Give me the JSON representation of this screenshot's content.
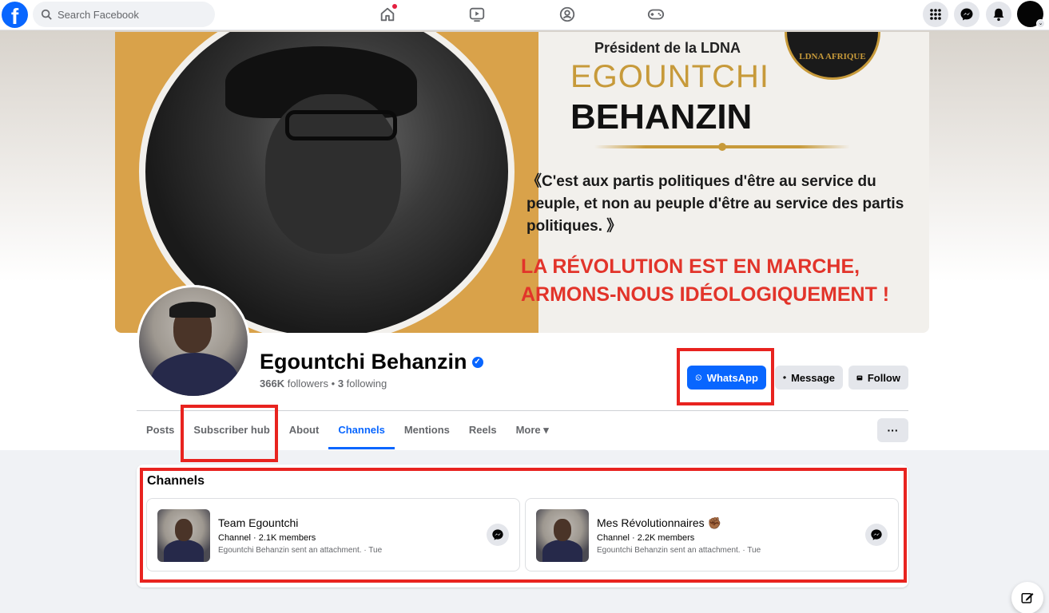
{
  "search": {
    "placeholder": "Search Facebook"
  },
  "nav": {
    "icons": [
      "home-icon",
      "video-icon",
      "groups-icon",
      "gaming-icon"
    ],
    "right_icons": [
      "menu-grid-icon",
      "messenger-icon",
      "bell-icon"
    ]
  },
  "cover": {
    "pres_label": "Président de la LDNA",
    "first_name": "EGOUNTCHI",
    "last_name": "BEHANZIN",
    "quote": "《C'est aux partis politiques d'être au service du peuple, et non au peuple d'être au service des partis politiques. 》",
    "slogan": "LA RÉVOLUTION EST EN MARCHE, ARMONS-NOUS IDÉOLOGIQUEMENT !",
    "logo_text": "LDNA AFRIQUE"
  },
  "profile": {
    "name": "Egountchi Behanzin",
    "verified": true,
    "followers": "366K",
    "followers_label": "followers",
    "following": "3",
    "following_label": "following",
    "separator": "•"
  },
  "actions": {
    "whatsapp": "WhatsApp",
    "message": "Message",
    "follow": "Follow"
  },
  "tabs": [
    {
      "label": "Posts"
    },
    {
      "label": "Subscriber hub"
    },
    {
      "label": "About"
    },
    {
      "label": "Channels",
      "active": true
    },
    {
      "label": "Mentions"
    },
    {
      "label": "Reels"
    },
    {
      "label": "More ▾"
    }
  ],
  "more_actions": "···",
  "channels": {
    "title": "Channels",
    "items": [
      {
        "name": "Team Egountchi",
        "meta": "Channel · 2.1K members",
        "last": "Egountchi Behanzin sent an attachment. · Tue"
      },
      {
        "name": "Mes Révolutionnaires ✊🏾",
        "meta": "Channel · 2.2K members",
        "last": "Egountchi Behanzin sent an attachment. · Tue"
      }
    ]
  },
  "colors": {
    "accent": "#0866ff",
    "highlight": "#e8231f",
    "cover_gold": "#d9a24a",
    "cover_red": "#e2342a"
  }
}
